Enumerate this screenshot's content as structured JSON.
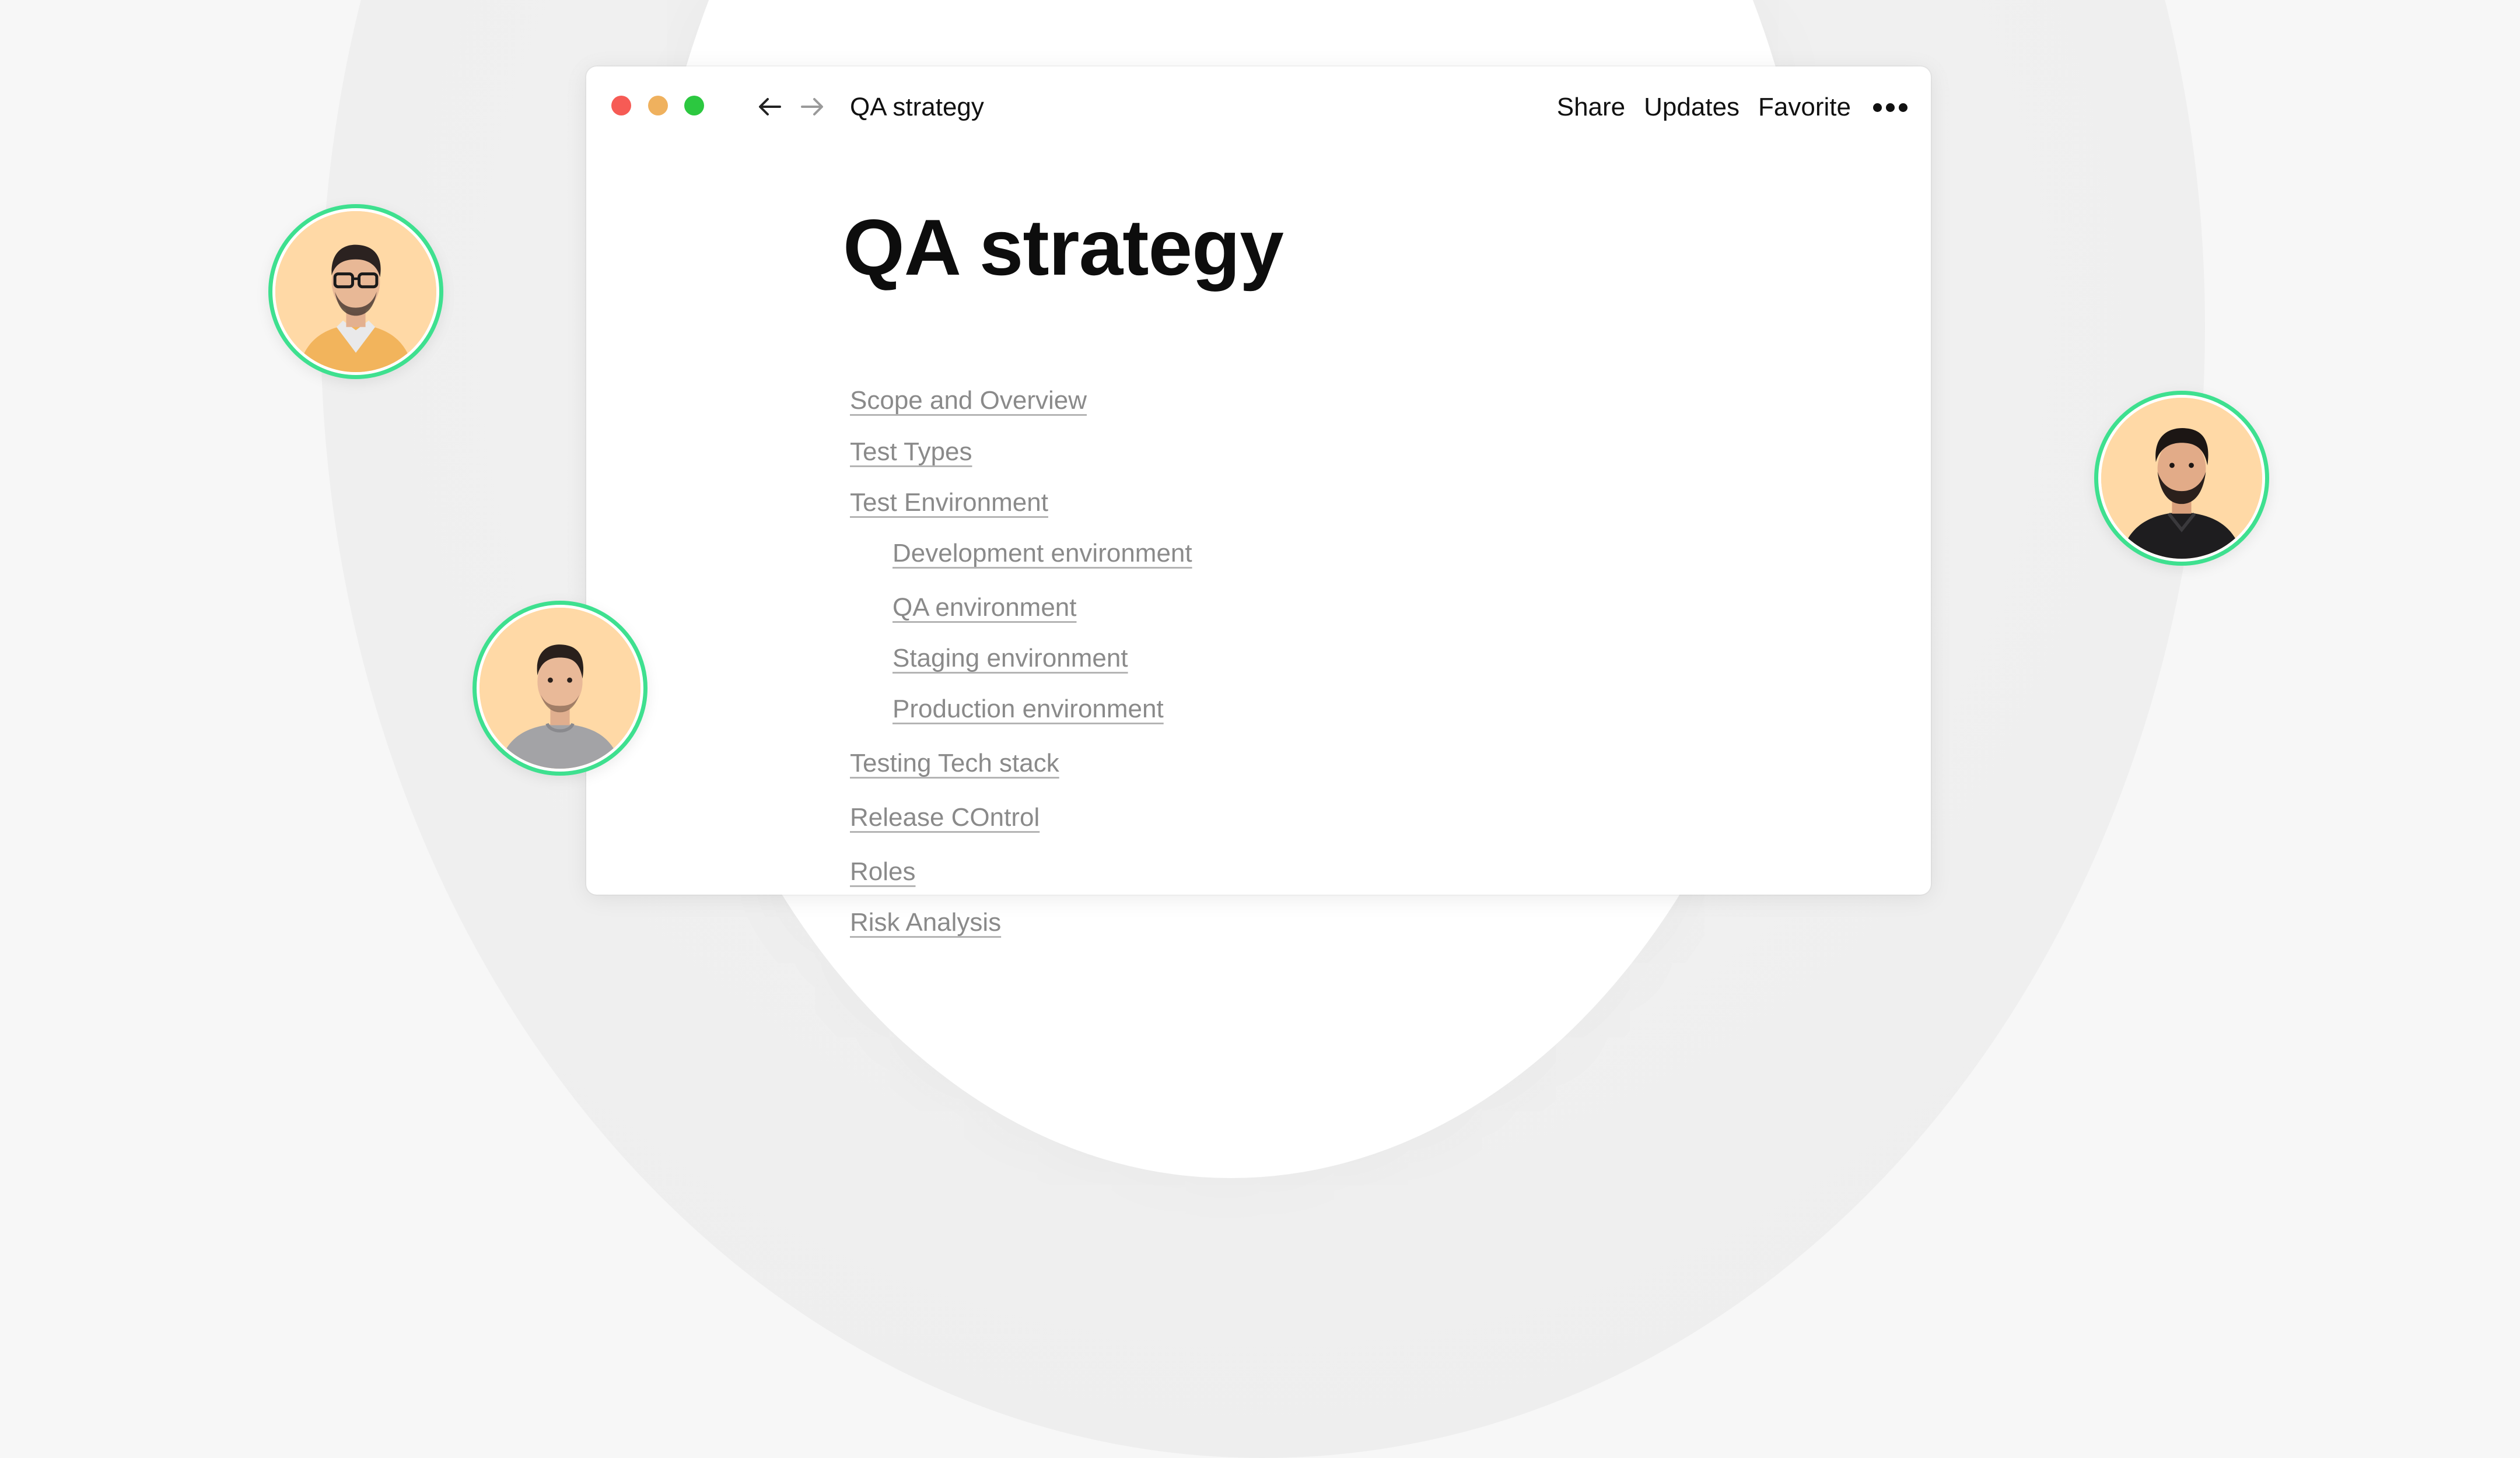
{
  "window": {
    "title": "QA strategy",
    "actions": {
      "share": "Share",
      "updates": "Updates",
      "favorite": "Favorite"
    }
  },
  "document": {
    "title": "QA strategy",
    "toc": [
      {
        "label": "Scope and Overview"
      },
      {
        "label": "Test Types"
      },
      {
        "label": "Test Environment"
      },
      {
        "label": "Development environment"
      },
      {
        "label": "QA environment"
      },
      {
        "label": "Staging environment"
      },
      {
        "label": "Production environment"
      },
      {
        "label": "Testing Tech stack"
      },
      {
        "label": "Release COntrol"
      },
      {
        "label": "Roles"
      },
      {
        "label": "Risk Analysis"
      }
    ]
  },
  "colors": {
    "accent_ring": "#3ee08f",
    "avatar_bg": "#ffd9a6",
    "traffic_red": "#f65b55",
    "traffic_yellow": "#efb15e",
    "traffic_green": "#2cc840"
  }
}
